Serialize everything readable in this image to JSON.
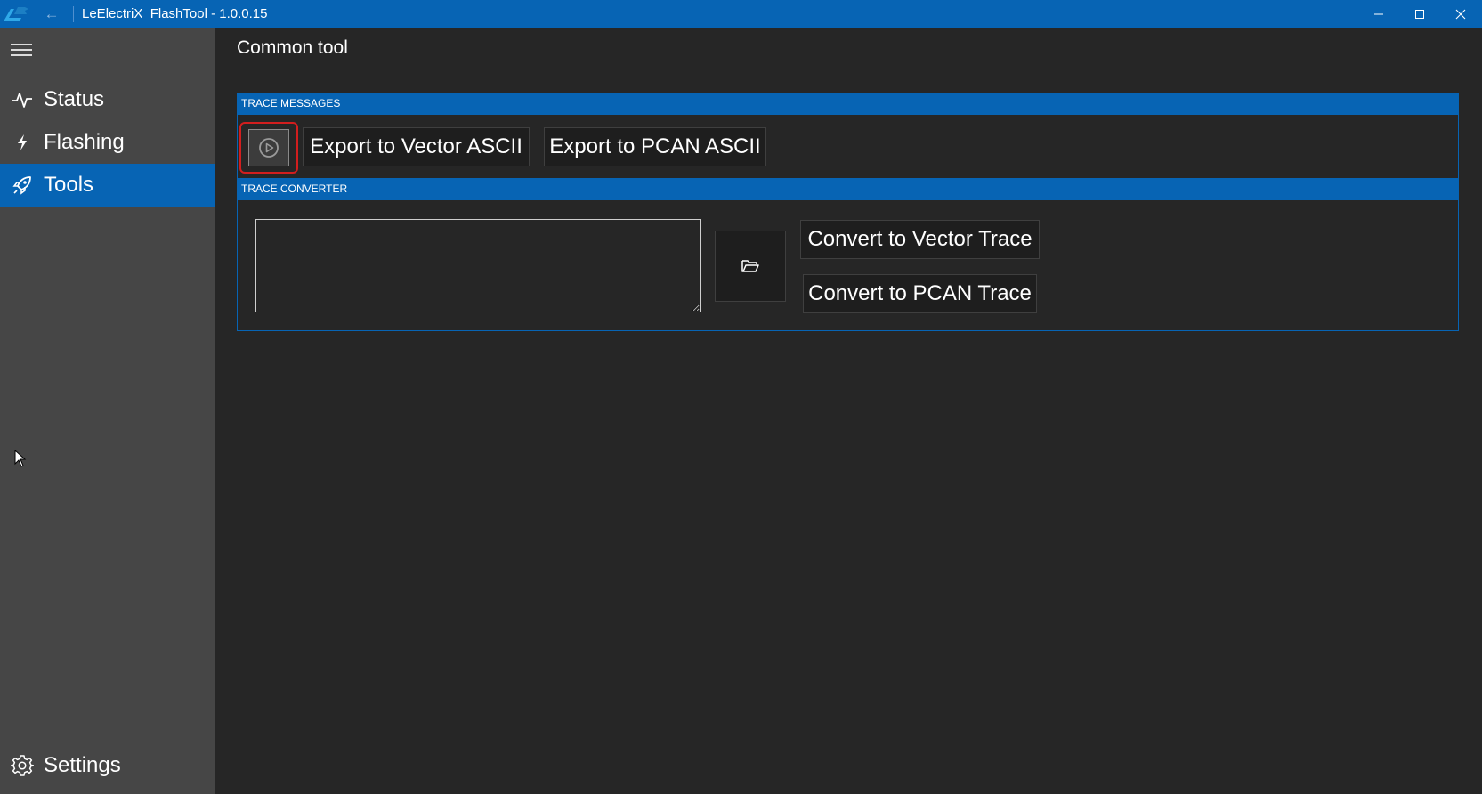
{
  "window": {
    "title": "LeElectriX_FlashTool - 1.0.0.15",
    "icons": {
      "app": "app-logo-icon",
      "back": "back-arrow-icon",
      "minimize": "minimize-icon",
      "maximize": "maximize-icon",
      "close": "close-icon"
    }
  },
  "sidebar": {
    "menu_icon": "hamburger-icon",
    "items": [
      {
        "label": "Status",
        "icon": "pulse-icon",
        "selected": false
      },
      {
        "label": "Flashing",
        "icon": "lightning-icon",
        "selected": false
      },
      {
        "label": "Tools",
        "icon": "rocket-icon",
        "selected": true
      }
    ],
    "settings": {
      "label": "Settings",
      "icon": "gear-icon"
    }
  },
  "main": {
    "title": "Common tool",
    "trace_messages": {
      "header": "TRACE MESSAGES",
      "play_icon": "play-circle-icon",
      "export_vector_label": "Export to Vector ASCII",
      "export_pcan_label": "Export to PCAN ASCII"
    },
    "trace_converter": {
      "header": "TRACE CONVERTER",
      "file_path_value": "",
      "folder_icon": "folder-open-icon",
      "convert_vector_label": "Convert to Vector Trace",
      "convert_pcan_label": "Convert to PCAN Trace"
    }
  },
  "colors": {
    "accent": "#0764b4",
    "sidebar_bg": "#464646",
    "main_bg": "#262626",
    "button_bg": "#1e1e1e",
    "highlight_outline": "#d21e1e"
  }
}
